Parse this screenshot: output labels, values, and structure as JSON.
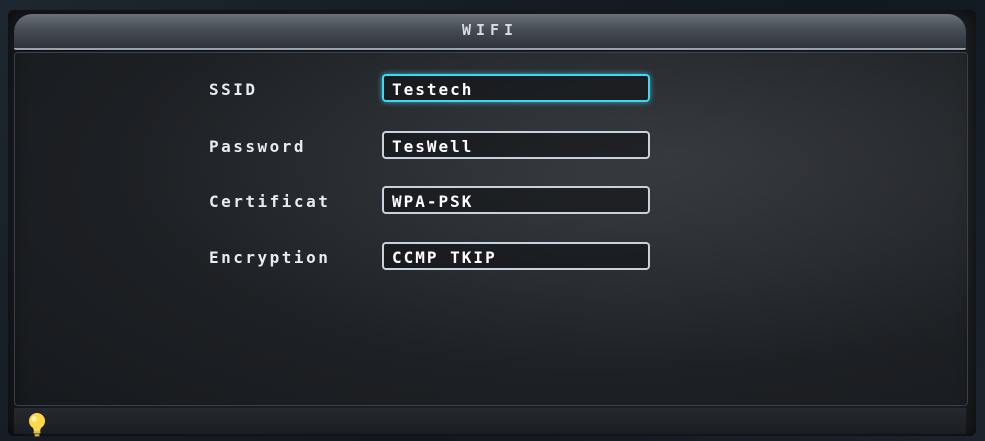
{
  "window": {
    "title": "WIFI"
  },
  "form": {
    "fields": [
      {
        "label": "SSID",
        "value": "Testech",
        "focused": true
      },
      {
        "label": "Password",
        "value": "TesWell",
        "focused": false
      },
      {
        "label": "Certificat",
        "value": "WPA-PSK",
        "focused": false
      },
      {
        "label": "Encryption",
        "value": "CCMP TKIP",
        "focused": false
      }
    ]
  },
  "footer": {
    "icon": "lightbulb-icon"
  },
  "colors": {
    "focus_border": "#3ed8f2",
    "field_border": "#c9d2dc",
    "label_text": "#e6ecf3",
    "bulb": "#ffd84a"
  }
}
